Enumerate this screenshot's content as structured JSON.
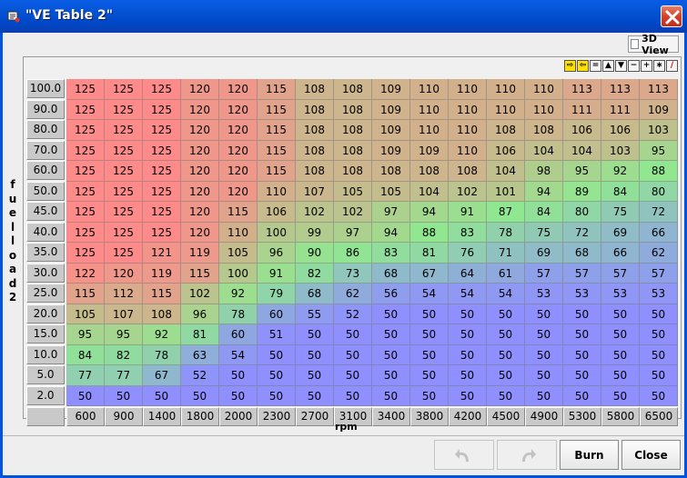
{
  "window": {
    "title": "\"VE Table 2\""
  },
  "view3d": {
    "label": "3D View",
    "checked": false
  },
  "axis": {
    "y_label": [
      "f",
      "u",
      "e",
      "l",
      "l",
      "o",
      "a",
      "d",
      "2"
    ],
    "x_label": "rpm"
  },
  "toolbar": {
    "tools": [
      "⇨",
      "⇦",
      "=",
      "▲",
      "▼",
      "−",
      "+",
      "∗",
      "∕"
    ]
  },
  "rows": [
    "100.0",
    "90.0",
    "80.0",
    "70.0",
    "60.0",
    "50.0",
    "45.0",
    "40.0",
    "35.0",
    "30.0",
    "25.0",
    "20.0",
    "15.0",
    "10.0",
    "5.0",
    "2.0"
  ],
  "cols": [
    "600",
    "900",
    "1400",
    "1800",
    "2000",
    "2300",
    "2700",
    "3100",
    "3400",
    "3800",
    "4200",
    "4500",
    "4900",
    "5300",
    "5800",
    "6500"
  ],
  "values": [
    [
      125,
      125,
      125,
      120,
      120,
      115,
      108,
      108,
      109,
      110,
      110,
      110,
      110,
      113,
      113,
      113
    ],
    [
      125,
      125,
      125,
      120,
      120,
      115,
      108,
      108,
      109,
      110,
      110,
      110,
      110,
      111,
      111,
      109
    ],
    [
      125,
      125,
      125,
      120,
      120,
      115,
      108,
      108,
      109,
      110,
      110,
      108,
      108,
      106,
      106,
      103
    ],
    [
      125,
      125,
      125,
      120,
      120,
      115,
      108,
      108,
      109,
      109,
      110,
      106,
      104,
      104,
      103,
      95
    ],
    [
      125,
      125,
      125,
      120,
      120,
      115,
      108,
      108,
      108,
      108,
      108,
      104,
      98,
      95,
      92,
      88
    ],
    [
      125,
      125,
      125,
      120,
      120,
      110,
      107,
      105,
      105,
      104,
      102,
      101,
      94,
      89,
      84,
      80
    ],
    [
      125,
      125,
      125,
      120,
      115,
      106,
      102,
      102,
      97,
      94,
      91,
      87,
      84,
      80,
      75,
      72
    ],
    [
      125,
      125,
      125,
      120,
      110,
      100,
      99,
      97,
      94,
      88,
      83,
      78,
      75,
      72,
      69,
      66
    ],
    [
      125,
      125,
      121,
      119,
      105,
      96,
      90,
      86,
      83,
      81,
      76,
      71,
      69,
      68,
      66,
      62
    ],
    [
      122,
      120,
      119,
      115,
      100,
      91,
      82,
      73,
      68,
      67,
      64,
      61,
      57,
      57,
      57,
      57
    ],
    [
      115,
      112,
      115,
      102,
      92,
      79,
      68,
      62,
      56,
      54,
      54,
      54,
      53,
      53,
      53,
      53
    ],
    [
      105,
      107,
      108,
      96,
      78,
      60,
      55,
      52,
      50,
      50,
      50,
      50,
      50,
      50,
      50,
      50
    ],
    [
      95,
      95,
      92,
      81,
      60,
      51,
      50,
      50,
      50,
      50,
      50,
      50,
      50,
      50,
      50,
      50
    ],
    [
      84,
      82,
      78,
      63,
      54,
      50,
      50,
      50,
      50,
      50,
      50,
      50,
      50,
      50,
      50,
      50
    ],
    [
      77,
      77,
      67,
      52,
      50,
      50,
      50,
      50,
      50,
      50,
      50,
      50,
      50,
      50,
      50,
      50
    ],
    [
      50,
      50,
      50,
      50,
      50,
      50,
      50,
      50,
      50,
      50,
      50,
      50,
      50,
      50,
      50,
      50
    ]
  ],
  "buttons": {
    "burn": "Burn",
    "close": "Close"
  },
  "colors": {
    "high": "#ff8a8a",
    "mid": "#90e890",
    "low": "#8f8fff"
  }
}
